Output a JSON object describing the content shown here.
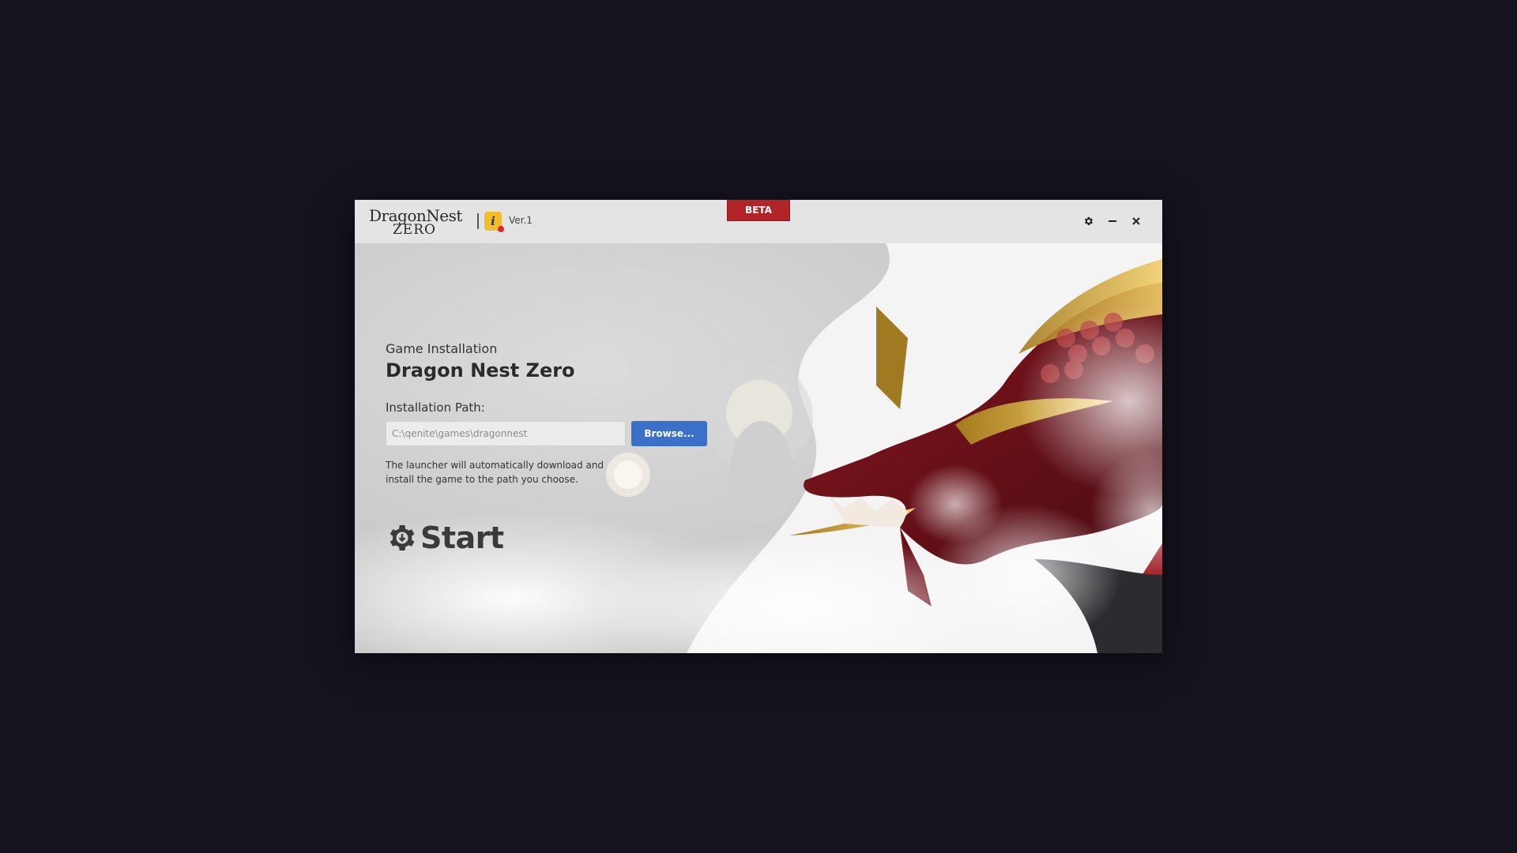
{
  "window": {
    "logo_line1": "DragonNest",
    "logo_line2": "ZERO",
    "version": "Ver.1",
    "beta_label": "BETA",
    "controls": {
      "settings_icon": "gear-icon",
      "minimize_icon": "minimize-icon",
      "close_icon": "close-icon"
    }
  },
  "install": {
    "subtitle": "Game Installation",
    "title": "Dragon Nest Zero",
    "path_label": "Installation Path:",
    "path_placeholder": "C:\\qenite\\games\\dragonnest",
    "browse_label": "Browse...",
    "note": "The launcher will automatically download and install the game to the path you choose.",
    "start_label": "Start"
  },
  "colors": {
    "beta": "#b32428",
    "browse": "#3b70c9",
    "info_badge": "#f0be2a",
    "notification_dot": "#e0242d"
  }
}
